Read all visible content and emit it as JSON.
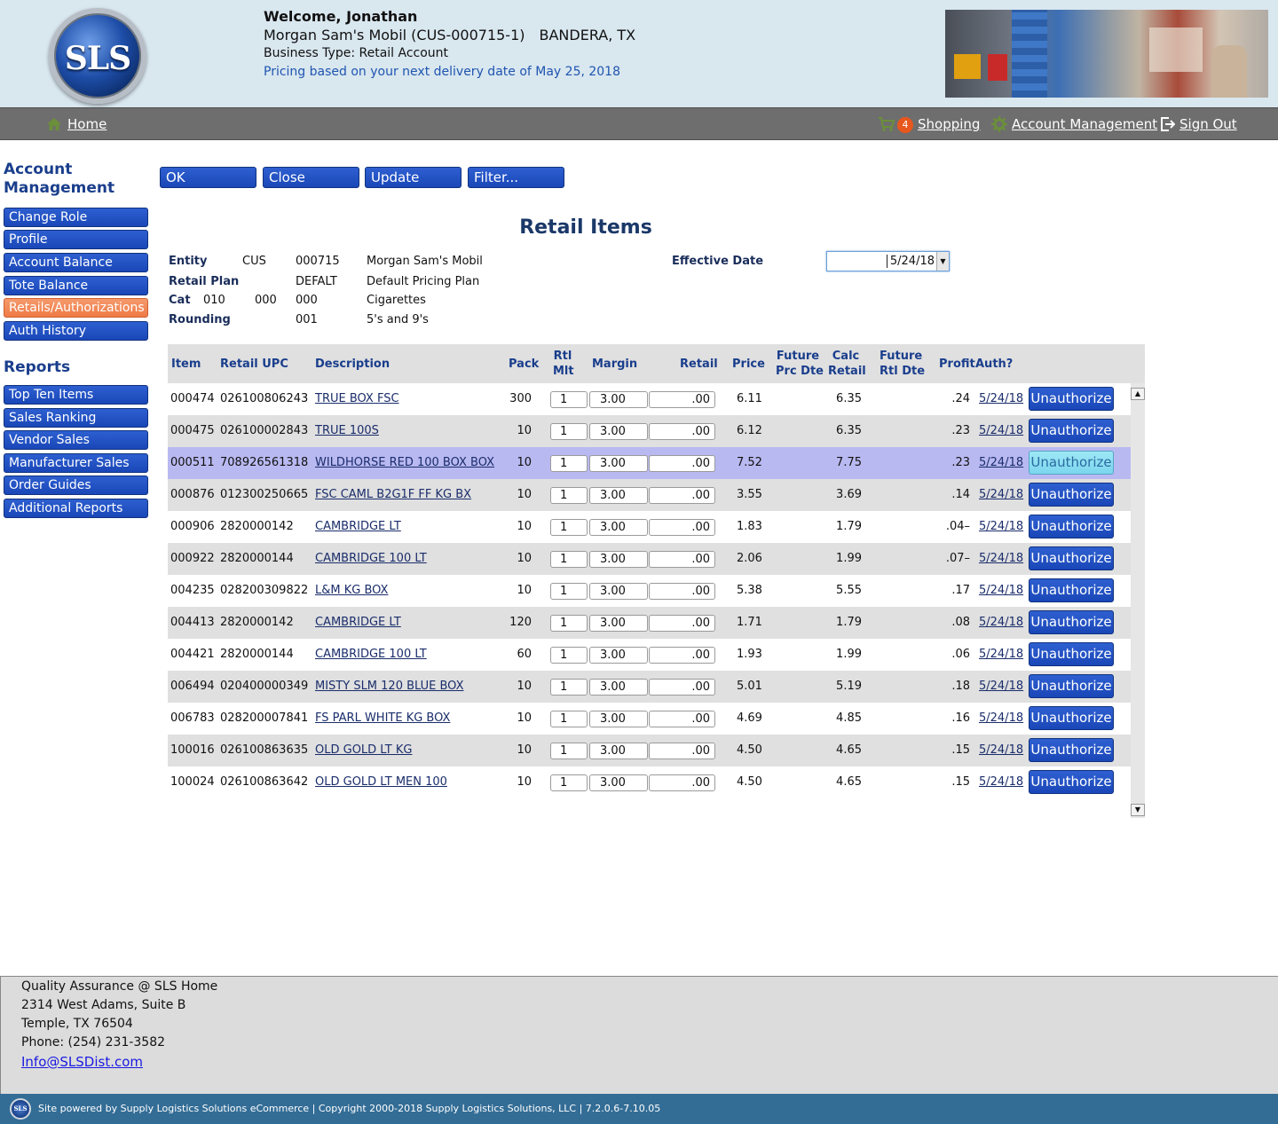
{
  "header": {
    "logo_text": "SLS",
    "welcome": "Welcome, Jonathan",
    "account": "Morgan Sam's Mobil (CUS-000715-1)",
    "location": "BANDERA, TX",
    "business_type": "Business Type: Retail Account",
    "pricing_note": "Pricing based on your next delivery date of May 25, 2018"
  },
  "nav": {
    "home": "Home",
    "cart_count": "4",
    "shopping": "Shopping",
    "account_management": "Account Management",
    "sign_out": "Sign Out"
  },
  "sidebar": {
    "heading_account_line1": "Account",
    "heading_account_line2": "Management",
    "account_items": [
      "Change Role",
      "Profile",
      "Account Balance",
      "Tote Balance",
      "Retails/Authorizations",
      "Auth History"
    ],
    "active_item": "Retails/Authorizations",
    "heading_reports": "Reports",
    "report_items": [
      "Top Ten Items",
      "Sales Ranking",
      "Vendor Sales",
      "Manufacturer Sales",
      "Order Guides",
      "Additional Reports"
    ]
  },
  "toolbar": {
    "ok": "OK",
    "close": "Close",
    "update": "Update",
    "filter": "Filter..."
  },
  "page_title": "Retail Items",
  "info": {
    "entity_label": "Entity",
    "entity_type": "CUS",
    "entity_num": "000715",
    "entity_name": "Morgan Sam's Mobil",
    "plan_label": "Retail Plan",
    "plan_code": "DEFALT",
    "plan_name": "Default Pricing Plan",
    "cat_label": "Cat",
    "cat_1": "010",
    "cat_2": "000",
    "cat_3": "000",
    "cat_name": "Cigarettes",
    "rounding_label": "Rounding",
    "rounding_code": "001",
    "rounding_name": "5's and 9's",
    "effective_label": "Effective Date",
    "effective_date": "5/24/18"
  },
  "table": {
    "headers": {
      "item": "Item",
      "upc": "Retail UPC",
      "description": "Description",
      "pack": "Pack",
      "rtl_mlt_1": "Rtl",
      "rtl_mlt_2": "Mlt",
      "margin": "Margin",
      "retail": "Retail",
      "price": "Price",
      "future_prc_1": "Future",
      "future_prc_2": "Prc Dte",
      "calc_retail_1": "Calc",
      "calc_retail_2": "Retail",
      "future_rtl_1": "Future",
      "future_rtl_2": "Rtl Dte",
      "profit": "Profit",
      "auth": "Auth?"
    },
    "button_label": "Unauthorize",
    "rows": [
      {
        "item": "000474",
        "upc": "026100806243",
        "desc": "TRUE BOX FSC",
        "pack": "300",
        "mlt": "1",
        "margin": "3.00",
        "retail": ".00",
        "price": "6.11",
        "calc": "6.35",
        "profit": ".24",
        "auth": "5/24/18"
      },
      {
        "item": "000475",
        "upc": "026100002843",
        "desc": "TRUE 100S",
        "pack": "10",
        "mlt": "1",
        "margin": "3.00",
        "retail": ".00",
        "price": "6.12",
        "calc": "6.35",
        "profit": ".23",
        "auth": "5/24/18"
      },
      {
        "item": "000511",
        "upc": "708926561318",
        "desc": "WILDHORSE RED 100 BOX BOX",
        "pack": "10",
        "mlt": "1",
        "margin": "3.00",
        "retail": ".00",
        "price": "7.52",
        "calc": "7.75",
        "profit": ".23",
        "auth": "5/24/18"
      },
      {
        "item": "000876",
        "upc": "012300250665",
        "desc": "FSC CAML B2G1F FF KG BX",
        "pack": "10",
        "mlt": "1",
        "margin": "3.00",
        "retail": ".00",
        "price": "3.55",
        "calc": "3.69",
        "profit": ".14",
        "auth": "5/24/18"
      },
      {
        "item": "000906",
        "upc": "2820000142",
        "desc": "CAMBRIDGE LT",
        "pack": "10",
        "mlt": "1",
        "margin": "3.00",
        "retail": ".00",
        "price": "1.83",
        "calc": "1.79",
        "profit": ".04–",
        "auth": "5/24/18"
      },
      {
        "item": "000922",
        "upc": "2820000144",
        "desc": "CAMBRIDGE 100 LT",
        "pack": "10",
        "mlt": "1",
        "margin": "3.00",
        "retail": ".00",
        "price": "2.06",
        "calc": "1.99",
        "profit": ".07–",
        "auth": "5/24/18"
      },
      {
        "item": "004235",
        "upc": "028200309822",
        "desc": "L&M KG BOX",
        "pack": "10",
        "mlt": "1",
        "margin": "3.00",
        "retail": ".00",
        "price": "5.38",
        "calc": "5.55",
        "profit": ".17",
        "auth": "5/24/18"
      },
      {
        "item": "004413",
        "upc": "2820000142",
        "desc": "CAMBRIDGE LT",
        "pack": "120",
        "mlt": "1",
        "margin": "3.00",
        "retail": ".00",
        "price": "1.71",
        "calc": "1.79",
        "profit": ".08",
        "auth": "5/24/18"
      },
      {
        "item": "004421",
        "upc": "2820000144",
        "desc": "CAMBRIDGE 100 LT",
        "pack": "60",
        "mlt": "1",
        "margin": "3.00",
        "retail": ".00",
        "price": "1.93",
        "calc": "1.99",
        "profit": ".06",
        "auth": "5/24/18"
      },
      {
        "item": "006494",
        "upc": "020400000349",
        "desc": "MISTY SLM 120 BLUE BOX",
        "pack": "10",
        "mlt": "1",
        "margin": "3.00",
        "retail": ".00",
        "price": "5.01",
        "calc": "5.19",
        "profit": ".18",
        "auth": "5/24/18"
      },
      {
        "item": "006783",
        "upc": "028200007841",
        "desc": "FS PARL WHITE KG BOX",
        "pack": "10",
        "mlt": "1",
        "margin": "3.00",
        "retail": ".00",
        "price": "4.69",
        "calc": "4.85",
        "profit": ".16",
        "auth": "5/24/18"
      },
      {
        "item": "100016",
        "upc": "026100863635",
        "desc": "OLD GOLD LT KG",
        "pack": "10",
        "mlt": "1",
        "margin": "3.00",
        "retail": ".00",
        "price": "4.50",
        "calc": "4.65",
        "profit": ".15",
        "auth": "5/24/18"
      },
      {
        "item": "100024",
        "upc": "026100863642",
        "desc": "OLD GOLD LT MEN 100",
        "pack": "10",
        "mlt": "1",
        "margin": "3.00",
        "retail": ".00",
        "price": "4.50",
        "calc": "4.65",
        "profit": ".15",
        "auth": "5/24/18"
      }
    ],
    "selected_index": 2
  },
  "footer": {
    "line1": "Quality Assurance @ SLS Home",
    "line2": "2314 West Adams, Suite B",
    "line3": "Temple, TX 76504",
    "phone": "Phone: (254) 231-3582",
    "email": "Info@SLSDist.com",
    "small_logo": "SLS",
    "copyright": "Site powered by Supply Logistics Solutions eCommerce | Copyright 2000-2018 Supply Logistics Solutions, LLC | 7.2.0.6-7.10.05"
  },
  "colors": {
    "accent_blue": "#1a47b8",
    "active_orange": "#ef7a46",
    "selected_row": "#b9b9f2",
    "heading_blue": "#1a3e8c",
    "badge_orange": "#e8571d"
  },
  "icons": {
    "home": "home-icon",
    "cart": "cart-icon",
    "gear": "gear-icon",
    "signout": "sign-out-icon",
    "scroll_up": "scroll-up-icon",
    "scroll_down": "scroll-down-icon"
  }
}
